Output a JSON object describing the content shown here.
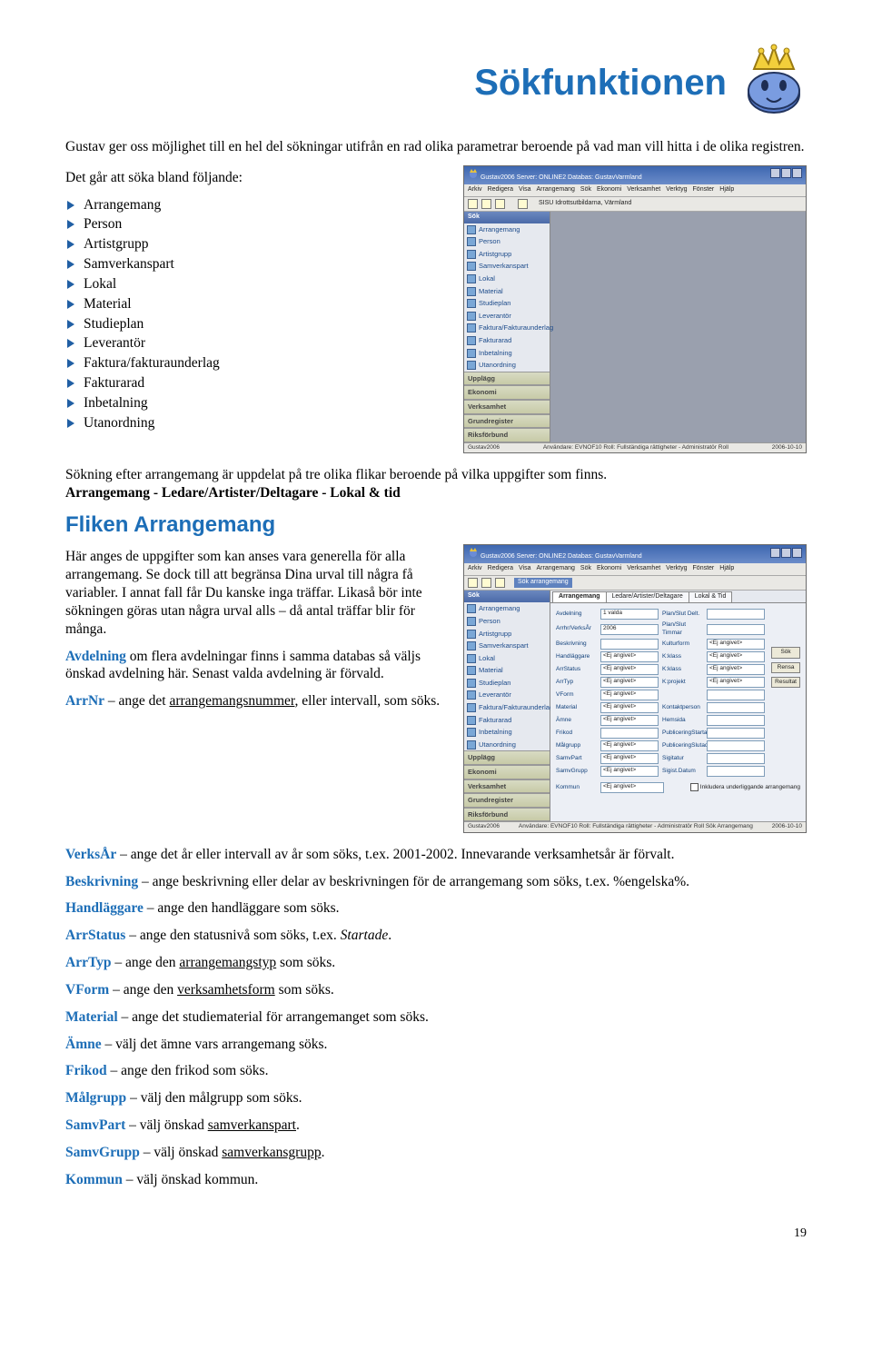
{
  "title": "Sökfunktionen",
  "intro": "Gustav ger oss möjlighet till en hel del sökningar utifrån en rad olika parametrar beroende på vad man vill hitta i de olika registren.",
  "list_intro": "Det går att söka bland följande:",
  "bullets": [
    "Arrangemang",
    "Person",
    "Artistgrupp",
    "Samverkanspart",
    "Lokal",
    "Material",
    "Studieplan",
    "Leverantör",
    "Faktura/fakturaunderlag",
    "Fakturarad",
    "Inbetalning",
    "Utanordning"
  ],
  "after_list": "Sökning efter arrangemang är uppdelat på tre olika flikar beroende på vilka uppgifter som finns.",
  "after_list_bold": "Arrangemang - Ledare/Artister/Deltagare - Lokal & tid",
  "section_heading": "Fliken Arrangemang",
  "section_p1a": "Här anges de uppgifter som kan anses vara generella för alla arrangemang. Se dock till att begränsa Dina urval till några få variabler. I annat fall får Du kanske inga träffar. Likaså bör inte sökningen göras utan några urval alls – då antal träffar blir för många.",
  "fields": [
    {
      "t": "Avdelning",
      "b": " om flera avdelningar finns i samma databas så väljs önskad avdelning här. Senast valda avdelning är förvald."
    },
    {
      "t": "ArrNr",
      "b": " – ange det ",
      "u": "arrangemangsnummer",
      "b2": ", eller intervall, som söks."
    },
    {
      "t": "VerksÅr",
      "b": " – ange det år eller intervall av år som söks, t.ex. 2001-2002. Innevarande verksamhetsår är förvalt."
    },
    {
      "t": "Beskrivning",
      "b": " – ange beskrivning eller delar av beskrivningen för de arrangemang som söks, t.ex. %engelska%."
    },
    {
      "t": "Handläggare",
      "b": " – ange den handläggare som söks."
    },
    {
      "t": "ArrStatus",
      "b": " – ange den statusnivå som söks, t.ex. ",
      "i": "Startade",
      "b2": "."
    },
    {
      "t": "ArrTyp",
      "b": " – ange den ",
      "u": "arrangemangstyp",
      "b2": " som söks."
    },
    {
      "t": "VForm",
      "b": " – ange den ",
      "u": "verksamhetsform",
      "b2": " som söks."
    },
    {
      "t": "Material",
      "b": " – ange det studiematerial för arrangemanget som söks."
    },
    {
      "t": "Ämne",
      "b": " – välj det ämne vars arrangemang söks."
    },
    {
      "t": "Frikod",
      "b": " – ange den frikod som söks."
    },
    {
      "t": "Målgrupp",
      "b": " – välj den målgrupp som söks."
    },
    {
      "t": "SamvPart",
      "b": " – välj önskad ",
      "u": "samverkanspart",
      "b2": "."
    },
    {
      "t": "SamvGrupp",
      "b": " – välj önskad ",
      "u": "samverkansgrupp",
      "b2": "."
    },
    {
      "t": "Kommun",
      "b": " – välj önskad kommun."
    }
  ],
  "page_num": "19",
  "ss1": {
    "title": "Gustav2006    Server: ONLINE2    Databas: GustavVarmland",
    "menu": [
      "Arkiv",
      "Redigera",
      "Visa",
      "Arrangemang",
      "Sök",
      "Ekonomi",
      "Verksamhet",
      "Verktyg",
      "Fönster",
      "Hjälp"
    ],
    "bread": "SISU Idrottsutbildarna, Värmland",
    "side_hdr": "Sök",
    "side_items": [
      "Arrangemang",
      "Person",
      "Artistgrupp",
      "Samverkanspart",
      "Lokal",
      "Material",
      "Studieplan",
      "Leverantör",
      "Faktura/Fakturaunderlag",
      "Fakturarad",
      "Inbetalning",
      "Utanordning"
    ],
    "bars": [
      "Upplägg",
      "Ekonomi",
      "Verksamhet",
      "Grundregister",
      "Riksförbund"
    ],
    "status_l": "Gustav2006",
    "status_m": "Användare: EVNOF10  Roll: Fullständiga rättigheter - Administratör  Roll",
    "status_r": "2006-10-10"
  },
  "ss2": {
    "title": "Gustav2006    Server: ONLINE2    Databas: GustavVarmland",
    "menu": [
      "Arkiv",
      "Redigera",
      "Visa",
      "Arrangemang",
      "Sök",
      "Ekonomi",
      "Verksamhet",
      "Verktyg",
      "Fönster",
      "Hjälp"
    ],
    "panel_hdr": "Sök arrangemang",
    "tabs": [
      "Arrangemang",
      "Ledare/Artister/Deltagare",
      "Lokal & Tid"
    ],
    "rows": [
      [
        "Avdelning",
        "1 valda",
        "Plan/Slut Delt.",
        ""
      ],
      [
        "Arrhr/VerksÅr",
        "2006",
        "Plan/Slut Timmar",
        ""
      ],
      [
        "Beskrivning",
        "",
        "Kulturform",
        "<Ej angivet>"
      ],
      [
        "Handläggare",
        "<Ej angivet>",
        "K:klass",
        "<Ej angivet>"
      ],
      [
        "ArrStatus",
        "<Ej angivet>",
        "K:klass",
        "<Ej angivet>"
      ],
      [
        "ArrTyp",
        "<Ej angivet>",
        "K:projekt",
        "<Ej angivet>"
      ],
      [
        "VForm",
        "<Ej angivet>",
        "",
        ""
      ],
      [
        "Material",
        "<Ej angivet>",
        "Kontaktperson",
        ""
      ],
      [
        "Ämne",
        "<Ej angivet>",
        "Hemsida",
        ""
      ],
      [
        "Frikod",
        "",
        "PubliceringStartad",
        ""
      ],
      [
        "Målgrupp",
        "<Ej angivet>",
        "PubliceringSlutad",
        ""
      ],
      [
        "SamvPart",
        "<Ej angivet>",
        "Sigitatur",
        ""
      ],
      [
        "SamvGrupp",
        "<Ej angivet>",
        "Sigist.Datum",
        ""
      ]
    ],
    "cbx": "Inkludera underliggande arrangemang",
    "btns": [
      "Sök",
      "Rensa",
      "Resultat"
    ],
    "kommun_lbl": "Kommun",
    "kommun_val": "<Ej angivet>",
    "status_l": "Gustav2006",
    "status_m": "Användare: EVNOF10  Roll: Fullständiga rättigheter - Administratör  Roll    Sök Arrangemang",
    "status_r": "2006-10-10"
  }
}
